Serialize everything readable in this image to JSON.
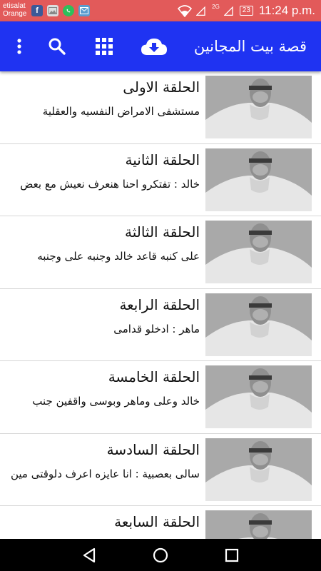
{
  "status_bar": {
    "carrier_line1": "etisalat",
    "carrier_line2": "Orange",
    "network_label": "2G",
    "battery": "23",
    "time": "11:24 p.m."
  },
  "app_bar": {
    "title": "قصة بيت المجانين",
    "icons": [
      "more-vert-icon",
      "search-icon",
      "grid-icon",
      "download-cloud-icon"
    ]
  },
  "episodes": [
    {
      "title": "الحلقة الاولى",
      "subtitle": "مستشفى الامراض النفسيه والعقلية"
    },
    {
      "title": "الحلقة الثانية",
      "subtitle": "خالد : تفتكرو احنا هنعرف نعيش مع بعض"
    },
    {
      "title": "الحلقة الثالثة",
      "subtitle": "على كنبه قاعد خالد وجنبه على وجنبه"
    },
    {
      "title": "الحلقة الرابعة",
      "subtitle": "ماهر : ادخلو قدامى"
    },
    {
      "title": "الحلقة الخامسة",
      "subtitle": "خالد وعلى وماهر وبوسى واقفين جنب"
    },
    {
      "title": "الحلقة السادسة",
      "subtitle": "سالى بعصبية : انا عايزه اعرف دلوقتى مين"
    },
    {
      "title": "الحلقة السابعة",
      "subtitle": ""
    }
  ],
  "nav_bar": {
    "icons": [
      "back-triangle-icon",
      "home-circle-icon",
      "recents-square-icon"
    ]
  }
}
